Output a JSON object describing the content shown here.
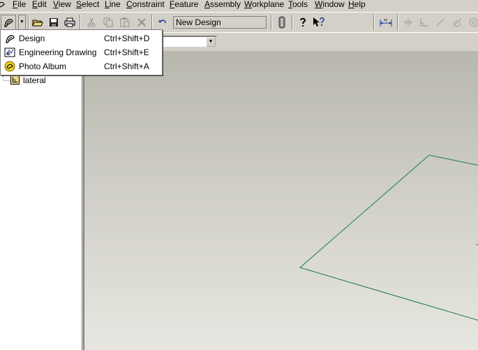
{
  "menubar": {
    "items": [
      {
        "label": "File"
      },
      {
        "label": "Edit"
      },
      {
        "label": "View"
      },
      {
        "label": "Select"
      },
      {
        "label": "Line"
      },
      {
        "label": "Constraint"
      },
      {
        "label": "Feature"
      },
      {
        "label": "Assembly"
      },
      {
        "label": "Workplane"
      },
      {
        "label": "Tools"
      },
      {
        "label": "Window"
      },
      {
        "label": "Help"
      }
    ]
  },
  "toolbar": {
    "design_name": "New Design",
    "icons": [
      "new-design-icon",
      "open-folder-icon",
      "save-icon",
      "print-icon",
      "cut-icon",
      "copy-icon",
      "paste-icon",
      "delete-icon",
      "undo-icon",
      "traffic-light-icon",
      "help-icon",
      "context-help-icon",
      "dimension-icon",
      "constraint-icon",
      "perpendicular-icon",
      "line-icon",
      "tangent-icon",
      "circle-icon"
    ]
  },
  "new_menu": {
    "items": [
      {
        "label": "Design",
        "shortcut": "Ctrl+Shift+D",
        "icon": "design-icon"
      },
      {
        "label": "Engineering Drawing",
        "shortcut": "Ctrl+Shift+E",
        "icon": "engineering-drawing-icon"
      },
      {
        "label": "Photo Album",
        "shortcut": "Ctrl+Shift+A",
        "icon": "photo-album-icon"
      }
    ]
  },
  "tree": {
    "items": [
      {
        "label": "lateral",
        "icon": "workplane-icon"
      }
    ]
  },
  "colors": {
    "chrome": "#d4d0c8",
    "sketch_line": "#1a7a4a"
  }
}
